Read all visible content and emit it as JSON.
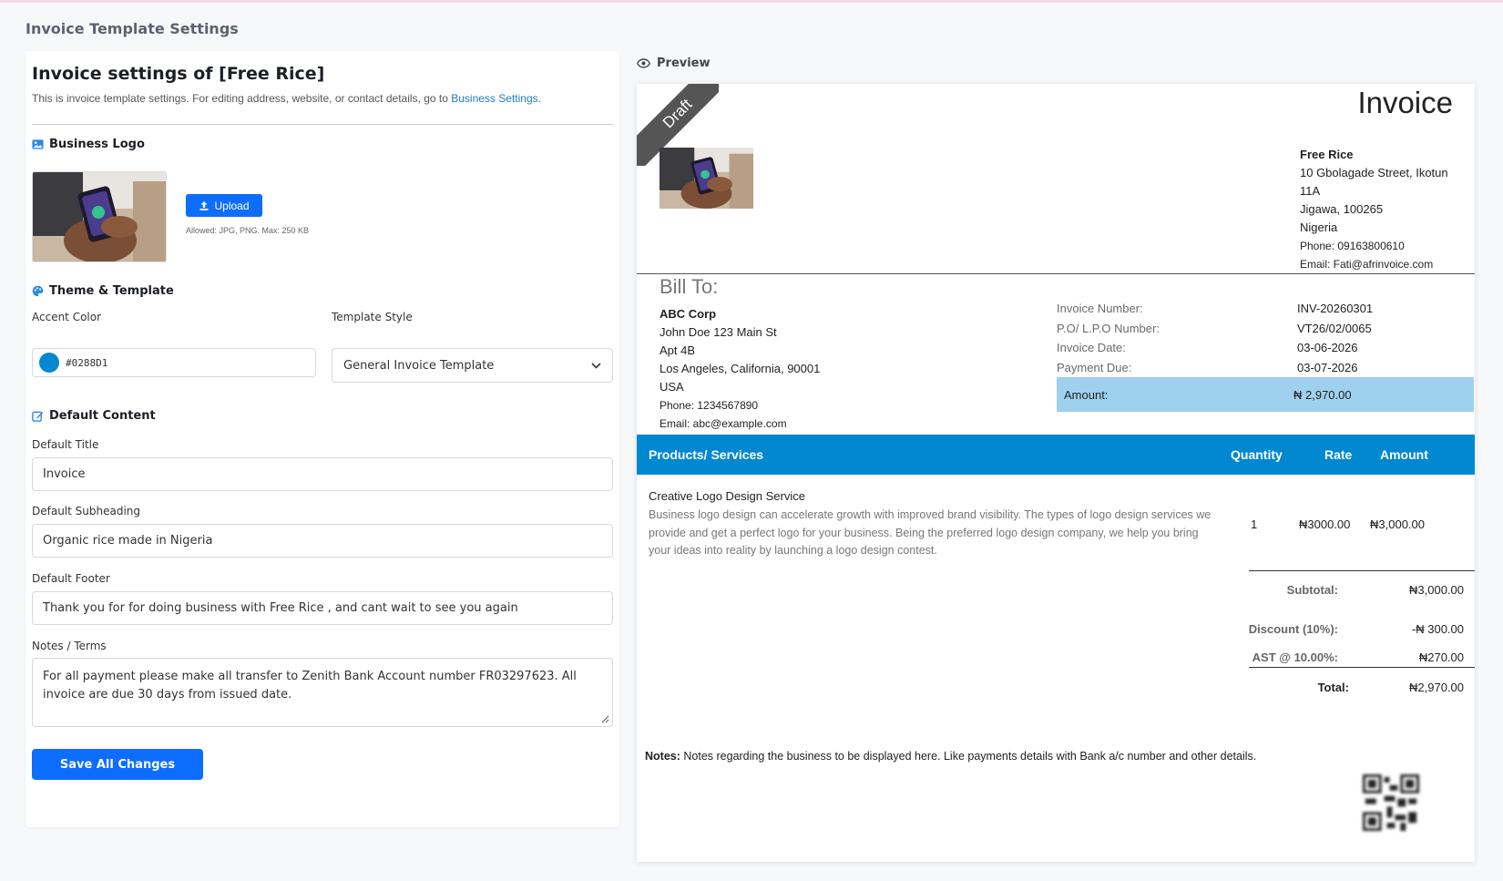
{
  "page_title": "Invoice Template Settings",
  "settings": {
    "heading": "Invoice settings of [Free Rice]",
    "description": "This is invoice template settings. For editing address, website, or contact details, go to",
    "description_link": "Business Settings.",
    "logo_section": {
      "title": "Business Logo",
      "upload_label": "Upload",
      "allowed_text": "Allowed: JPG, PNG. Max: 250 KB"
    },
    "theme_section": {
      "title": "Theme & Template",
      "accent_label": "Accent Color",
      "accent_value": "#0288D1",
      "template_label": "Template Style",
      "template_value": "General Invoice Template"
    },
    "content_section": {
      "title": "Default Content",
      "title_label": "Default Title",
      "title_value": "Invoice",
      "subheading_label": "Default Subheading",
      "subheading_value": "Organic rice made in Nigeria",
      "footer_label": "Default Footer",
      "footer_value": "Thank you for for doing business with Free Rice , and cant wait to see you again",
      "notes_label": "Notes / Terms",
      "notes_value": "For all payment please make all transfer to Zenith Bank Account number FR03297623. All invoice are due 30 days from issued date."
    },
    "save_label": "Save All Changes"
  },
  "preview": {
    "label": "Preview",
    "draft_label": "Draft",
    "title": "Invoice",
    "business": {
      "name": "Free Rice",
      "address1": "10 Gbolagade Street, Ikotun",
      "address2": "11A",
      "address3": "Jigawa, 100265",
      "country": "Nigeria",
      "phone": "Phone: 09163800610",
      "email": "Email: Fati@afrinvoice.com"
    },
    "bill_to_label": "Bill To:",
    "client": {
      "name": "ABC Corp",
      "line1": "John Doe 123 Main St",
      "line2": "Apt 4B",
      "line3": "Los Angeles, California, 90001",
      "country": "USA",
      "phone": "Phone: 1234567890",
      "email": "Email: abc@example.com"
    },
    "meta": [
      {
        "label": "Invoice Number:",
        "value": "INV-20260301"
      },
      {
        "label": "P.O/ L.P.O Number:",
        "value": "VT26/02/0065"
      },
      {
        "label": "Invoice Date:",
        "value": "03-06-2026"
      },
      {
        "label": "Payment Due:",
        "value": "03-07-2026"
      }
    ],
    "amount_label": "Amount:",
    "amount_value": "₦ 2,970.00",
    "table_headers": {
      "products": "Products/ Services",
      "quantity": "Quantity",
      "rate": "Rate",
      "amount": "Amount"
    },
    "item": {
      "name": "Creative Logo Design Service",
      "description": "Business logo design can accelerate growth with improved brand visibility. The types of logo design services we provide and get a perfect logo for your business. Being the preferred logo design company, we help you bring your ideas into reality by launching a logo design contest.",
      "quantity": "1",
      "rate": "₦3000.00",
      "amount": "₦3,000.00"
    },
    "totals": {
      "subtotal_label": "Subtotal:",
      "subtotal_value": "₦3,000.00",
      "discount_label": "Discount (10%):",
      "discount_value": "-₦ 300.00",
      "tax_label": "AST @ 10.00%:",
      "tax_value": "₦270.00",
      "total_label": "Total:",
      "total_value": "₦2,970.00"
    },
    "notes_label": "Notes:",
    "notes_text": " Notes regarding the business to be displayed here. Like payments details with Bank a/c number and other details."
  },
  "colors": {
    "accent": "#0288D1",
    "primary_button": "#0d6efd",
    "amount_highlight": "#9fd1ee"
  }
}
